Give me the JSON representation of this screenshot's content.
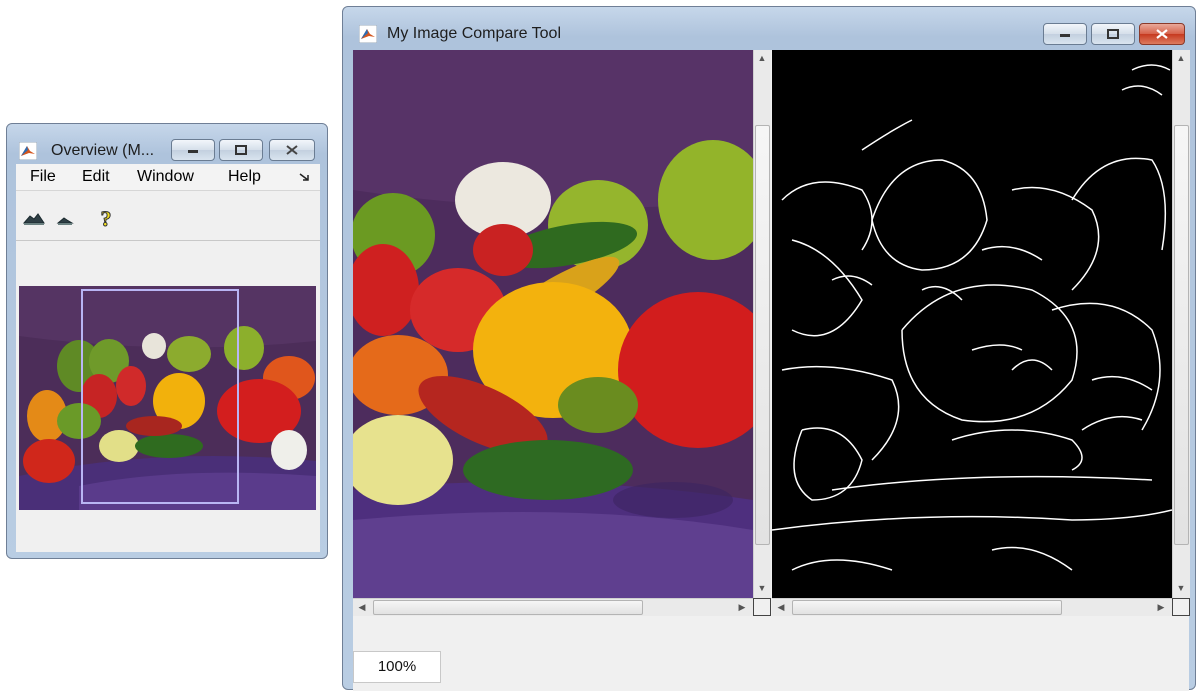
{
  "overview": {
    "title": "Overview (M...",
    "menu": [
      "File",
      "Edit",
      "Window",
      "Help"
    ],
    "toolbar_icons": [
      "zoom-in-icon",
      "zoom-out-icon",
      "help-icon"
    ]
  },
  "compare": {
    "title": "My Image Compare Tool",
    "zoom_label": "100%"
  },
  "colors": {
    "window_frame": "#b9cde3",
    "client_bg": "#f0f0f0",
    "close_button": "#c6391f",
    "overview_rect": "#b9b5f4",
    "backdrop_purple": "#4f2e5a",
    "edge_image_bg": "#000000"
  }
}
